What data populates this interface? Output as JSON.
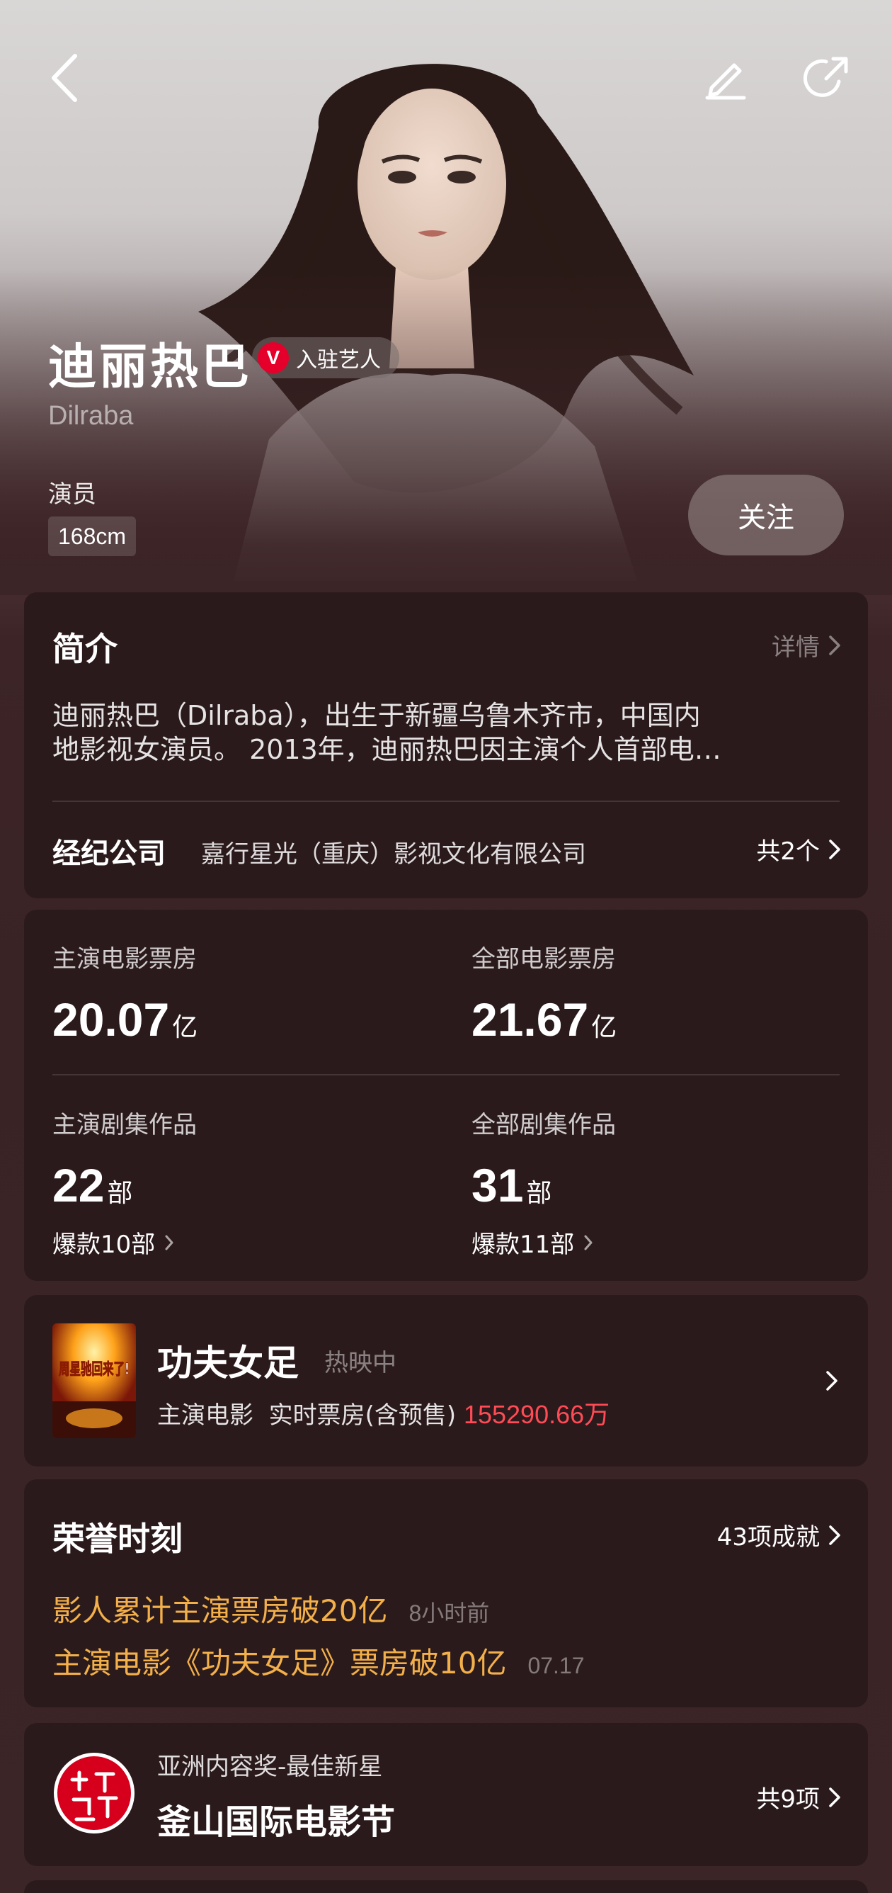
{
  "header": {
    "back_icon": "back-chevron-icon",
    "edit_icon": "edit-pencil-icon",
    "share_icon": "share-icon"
  },
  "profile": {
    "name": "迪丽热巴",
    "badge_label": "入驻艺人",
    "badge_letter": "V",
    "english_name": "Dilraba",
    "occupation": "演员",
    "height": "168cm",
    "follow_label": "关注"
  },
  "intro": {
    "title": "简介",
    "details_label": "详情",
    "text_line1": "迪丽热巴（Dilraba），出生于新疆乌鲁木齐市，中国内",
    "text_line2": "地影视女演员。 2013年，迪丽热巴因主演个人首部电…",
    "agency_label": "经纪公司",
    "agency_name": "嘉行星光（重庆）影视文化有限公司",
    "agency_count": "共2个"
  },
  "stats": {
    "lead_box_office": {
      "label": "主演电影票房",
      "value": "20.07",
      "unit": "亿"
    },
    "total_box_office": {
      "label": "全部电影票房",
      "value": "21.67",
      "unit": "亿"
    },
    "lead_series": {
      "label": "主演剧集作品",
      "value": "22",
      "unit": "部",
      "hits": "爆款10部"
    },
    "total_series": {
      "label": "全部剧集作品",
      "value": "31",
      "unit": "部",
      "hits": "爆款11部"
    }
  },
  "movie": {
    "title": "功夫女足",
    "status": "热映中",
    "role": "主演电影",
    "realtime_label": "实时票房(含预售)",
    "box_office": "155290.66万",
    "poster_text": "周星驰回来了!"
  },
  "honors": {
    "title": "荣誉时刻",
    "count_label": "43项成就",
    "items": [
      {
        "text": "影人累计主演票房破20亿",
        "time": "8小时前"
      },
      {
        "text": "主演电影《功夫女足》票房破10亿",
        "time": "07.17"
      }
    ]
  },
  "award": {
    "subtitle": "亚洲内容奖-最佳新星",
    "name": "釜山国际电影节",
    "count_label": "共9项"
  },
  "colors": {
    "accent_red": "#ff4b55",
    "honor_gold": "#f3b04a",
    "card_bg": "#2b1a1c",
    "page_bg": "#3b2426"
  }
}
